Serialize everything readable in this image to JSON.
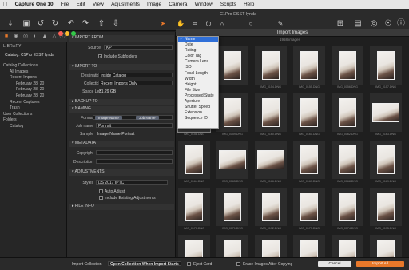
{
  "menubar": {
    "app_name": "Capture One 10",
    "items": [
      "File",
      "Edit",
      "View",
      "Adjustments",
      "Image",
      "Camera",
      "Window",
      "Scripts",
      "Help"
    ]
  },
  "window": {
    "document_title": "C1Pro ESST lynda",
    "dialog_title": "Import Images"
  },
  "library": {
    "header": "LIBRARY",
    "catalog_name": "Catalog: C1Pro ESST lynda",
    "tree": [
      {
        "label": "Catalog Collections",
        "indent": 0,
        "selected": false
      },
      {
        "label": "All Images",
        "indent": 1,
        "selected": false
      },
      {
        "label": "Recent Imports",
        "indent": 1,
        "selected": false
      },
      {
        "label": "February 28, 20",
        "indent": 2,
        "selected": false
      },
      {
        "label": "February 28, 20",
        "indent": 2,
        "selected": true
      },
      {
        "label": "February 28, 20",
        "indent": 2,
        "selected": false
      },
      {
        "label": "Recent Captures",
        "indent": 1,
        "selected": false
      },
      {
        "label": "Trash",
        "indent": 1,
        "selected": false
      },
      {
        "label": "User Collections",
        "indent": 0,
        "selected": false
      },
      {
        "label": "Folders",
        "indent": 0,
        "selected": false
      },
      {
        "label": "Catalog",
        "indent": 1,
        "selected": false
      }
    ]
  },
  "import_from": {
    "title": "IMPORT FROM",
    "source_label": "Source",
    "source_value": "KP",
    "include_subfolders_label": "Include Subfolders",
    "include_subfolders": true
  },
  "import_to": {
    "title": "IMPORT TO",
    "destination_label": "Destination",
    "destination_value": "Inside Catalog",
    "collection_label": "Collection",
    "collection_value": "Recent Imports Only",
    "space_left_label": "Space Left",
    "space_left_value": "31.29 GB"
  },
  "backup_to": {
    "title": "BACKUP TO"
  },
  "naming": {
    "title": "NAMING",
    "format_label": "Format",
    "format_tokens": [
      "Image Name",
      "Job Name"
    ],
    "job_name_label": "Job name",
    "job_name_value": "Portrait",
    "sample_label": "Sample",
    "sample_value": "Image Name-Portrait"
  },
  "metadata": {
    "title": "METADATA",
    "copyright_label": "Copyright",
    "description_label": "Description"
  },
  "adjustments": {
    "title": "ADJUSTMENTS",
    "styles_label": "Styles",
    "styles_value": "DS 2017 IPTC",
    "auto_adjust_label": "Auto Adjust",
    "auto_adjust": false,
    "include_existing_label": "Include Existing Adjustments",
    "include_existing": false
  },
  "file_info": {
    "title": "FILE INFO"
  },
  "sort_menu": {
    "options": [
      "Name",
      "Date",
      "Rating",
      "Color Tag",
      "Camera Lens",
      "ISO",
      "Focal Length",
      "Width",
      "Height",
      "File Size",
      "Processed State",
      "Aperture",
      "Shutter Speed",
      "Extension",
      "Sequence ID"
    ],
    "selected": "Name"
  },
  "browser": {
    "count_label": "1958 images",
    "thumbnails": [
      [
        "",
        "",
        "IMG_0154.DNG",
        "IMG_0155.DNG",
        "IMG_0156.DNG",
        "IMG_0157.DNG"
      ],
      [
        "IMG_0158.DNG",
        "IMG_0159.DNG",
        "IMG_0160.DNG",
        "IMG_0161.DNG",
        "IMG_0162.DNG",
        "IMG_0163.DNG"
      ],
      [
        "IMG_0164.DNG",
        "IMG_0165.DNG",
        "IMG_0166.DNG",
        "IMG_0167.DNG",
        "IMG_0168.DNG",
        "IMG_0169.DNG"
      ],
      [
        "IMG_0170.DNG",
        "IMG_0171.DNG",
        "IMG_0172.DNG",
        "IMG_0173.DNG",
        "IMG_0174.DNG",
        "IMG_0175.DNG"
      ],
      [
        "IMG_0176.DNG",
        "IMG_0177.DNG",
        "IMG_0178.DNG",
        "IMG_0179.DNG",
        "IMG_0180.DNG",
        "IMG_0181.DNG"
      ]
    ]
  },
  "bottom_bar": {
    "import_collection_label": "Import Collection",
    "import_collection_value": "Open Collection When Import Starts",
    "eject_card_label": "Eject Card",
    "eject_card": false,
    "erase_label": "Erase Images After Copying",
    "erase": false,
    "cancel_label": "Cancel",
    "import_all_label": "Import All"
  },
  "colors": {
    "accent_orange": "#e8782a",
    "selection_blue": "#2f6fd8",
    "traffic_red": "#fc5f57",
    "traffic_yellow": "#fdbc2e",
    "traffic_green": "#33c748"
  },
  "icons": {
    "toolbar": [
      "import-icon",
      "camera-icon",
      "rotate-left-icon",
      "rotate-right-icon",
      "undo-icon",
      "redo-icon",
      "copy-adjustments-icon",
      "apply-adjustments-icon",
      "cursor-icon",
      "pan-icon",
      "crop-icon",
      "rotate-icon",
      "keystone-icon",
      "spot-icon",
      "picker-icon",
      "grid-icon",
      "viewer-icon",
      "exposure-icon",
      "proof-icon",
      "help-icon"
    ]
  }
}
